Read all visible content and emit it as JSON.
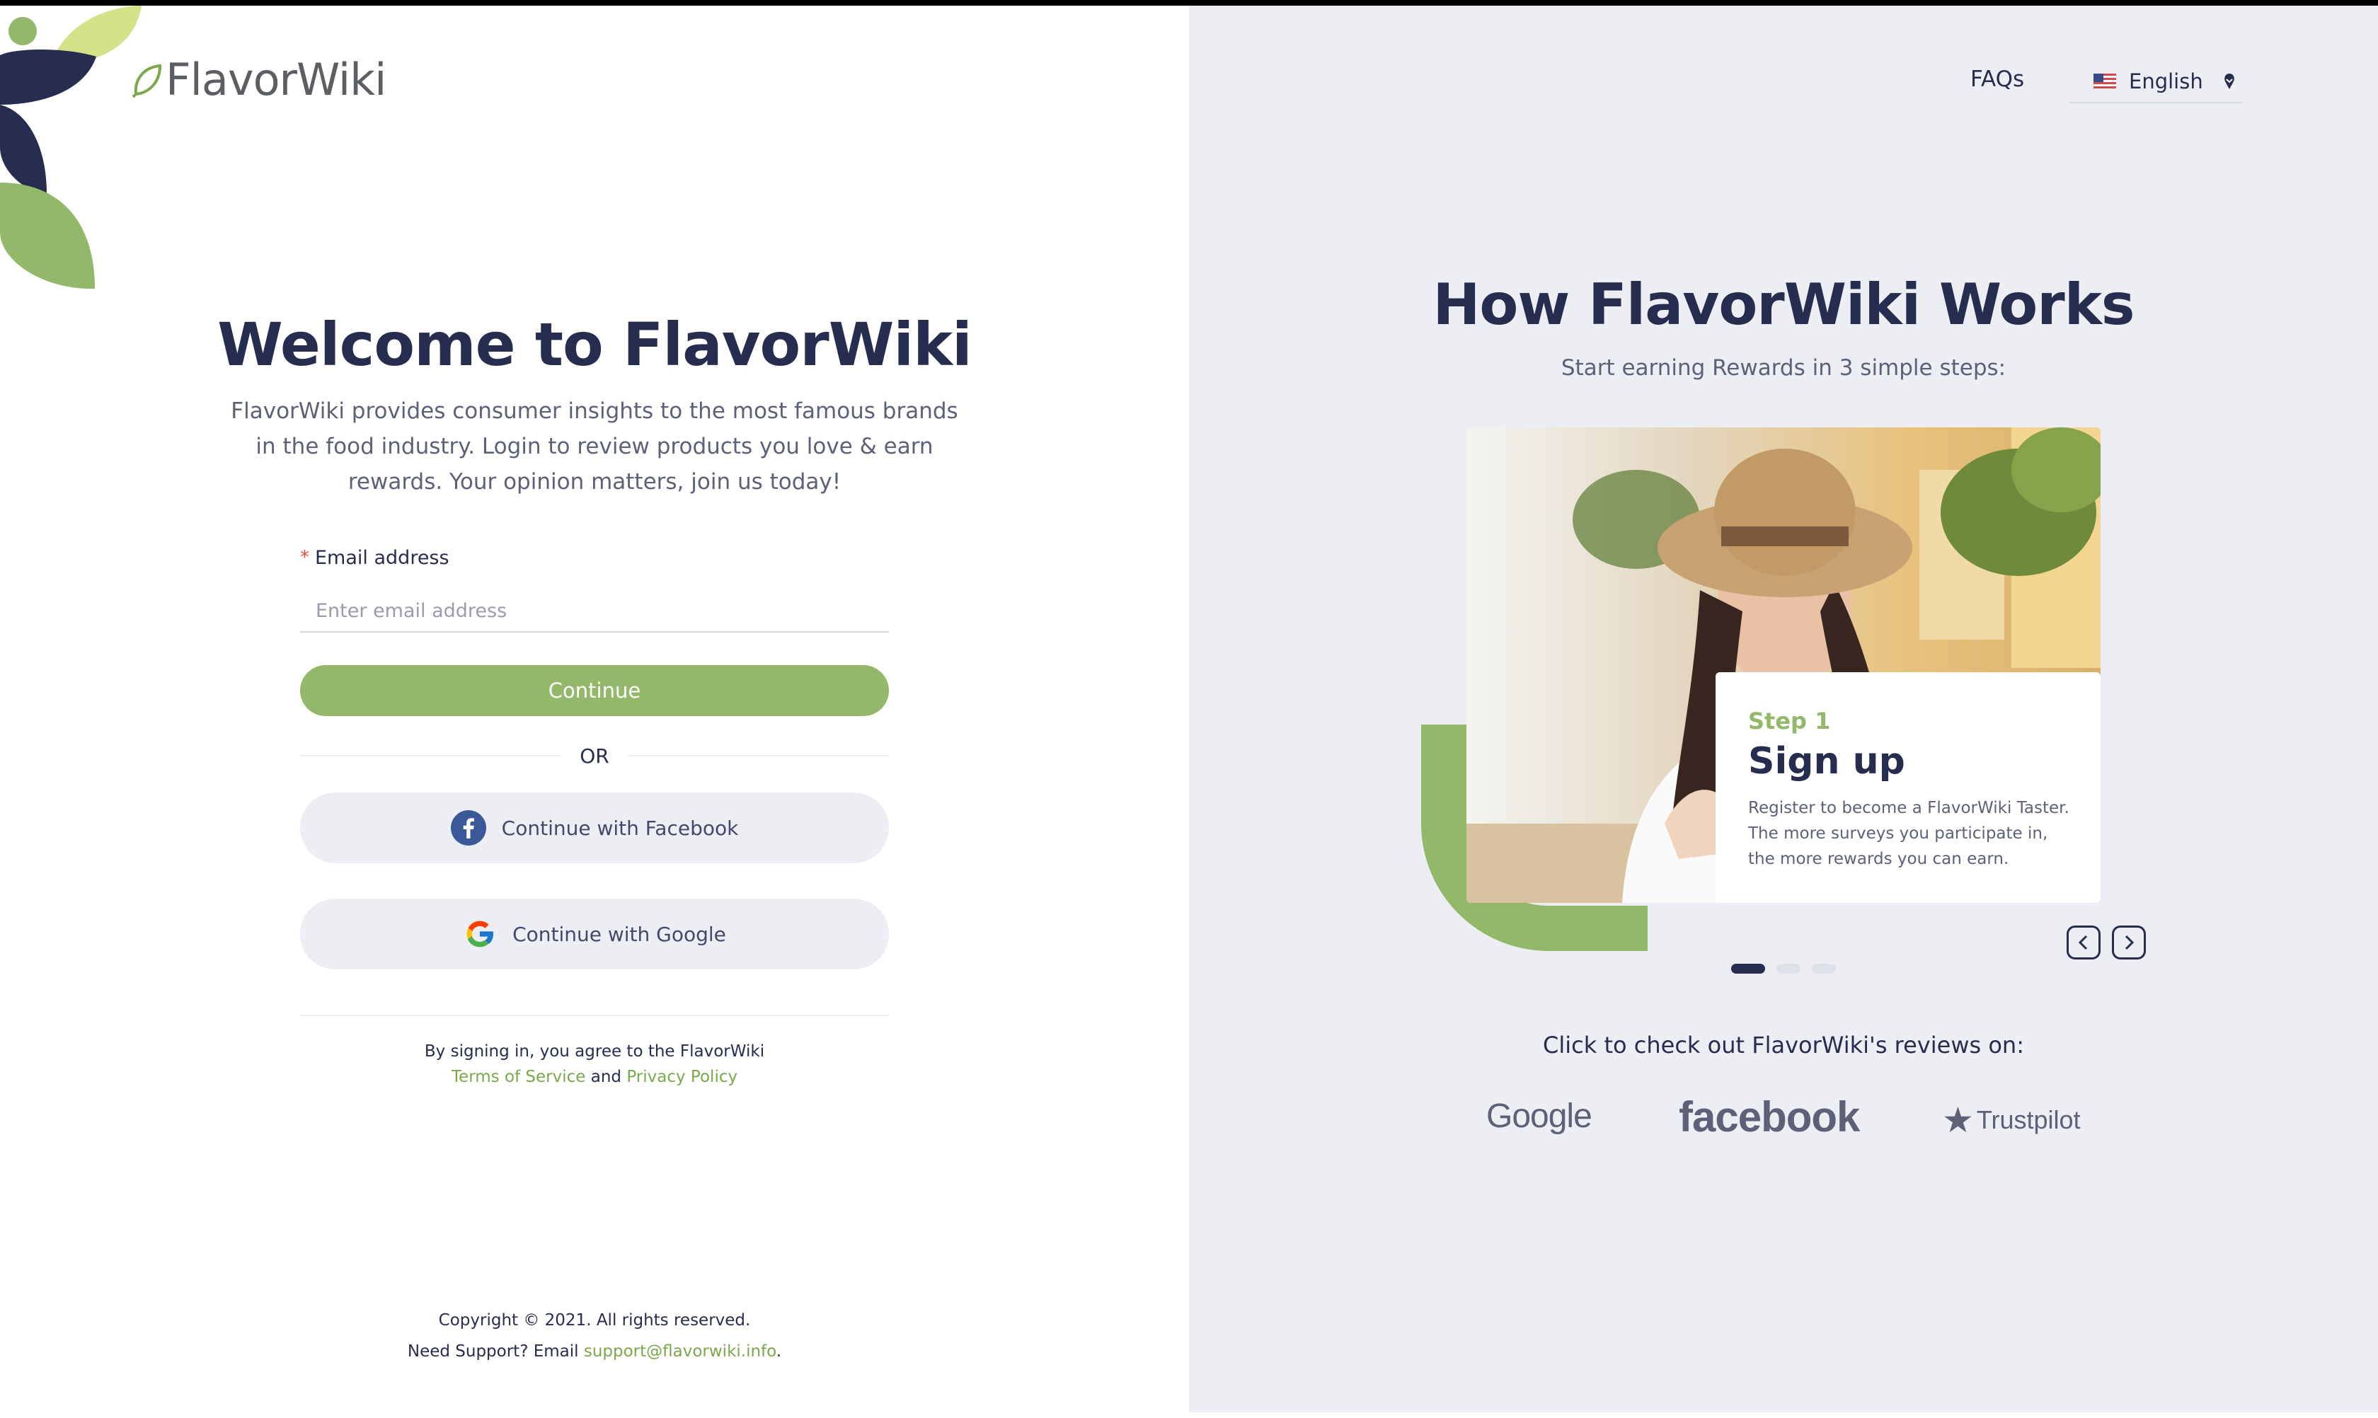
{
  "brand": {
    "name": "FlavorWiki"
  },
  "welcome": {
    "title": "Welcome to FlavorWiki",
    "intro": "FlavorWiki provides consumer insights to the most famous brands in the food industry. Login to review products you love & earn rewards. Your opinion matters, join us today!"
  },
  "form": {
    "email_label": "Email address",
    "email_placeholder": "Enter email address",
    "email_value": "",
    "continue_label": "Continue",
    "or_label": "OR",
    "facebook_label": "Continue with Facebook",
    "google_label": "Continue with Google"
  },
  "terms": {
    "prefix": "By signing in, you agree to the FlavorWiki",
    "terms_link": "Terms of Service",
    "and": "and",
    "privacy_link": "Privacy Policy"
  },
  "footer": {
    "copyright": "Copyright © 2021. All rights reserved.",
    "support_prefix": "Need Support? Email",
    "support_email": "support@flavorwiki.info",
    "support_suffix": "."
  },
  "header": {
    "faqs": "FAQs",
    "language": "English"
  },
  "how": {
    "title": "How FlavorWiki Works",
    "subtitle": "Start earning Rewards in 3 simple steps:"
  },
  "carousel": {
    "step_label": "Step 1",
    "step_title": "Sign up",
    "step_desc": "Register to become a FlavorWiki Taster. The more surveys you participate in, the more rewards you can earn.",
    "total_slides": 3,
    "active_slide": 1
  },
  "reviews": {
    "title": "Click to check out FlavorWiki's reviews on:",
    "google": "Google",
    "facebook": "facebook",
    "trustpilot": "Trustpilot"
  },
  "colors": {
    "navy": "#272d4e",
    "green": "#93b869",
    "panel": "#eceef4"
  }
}
